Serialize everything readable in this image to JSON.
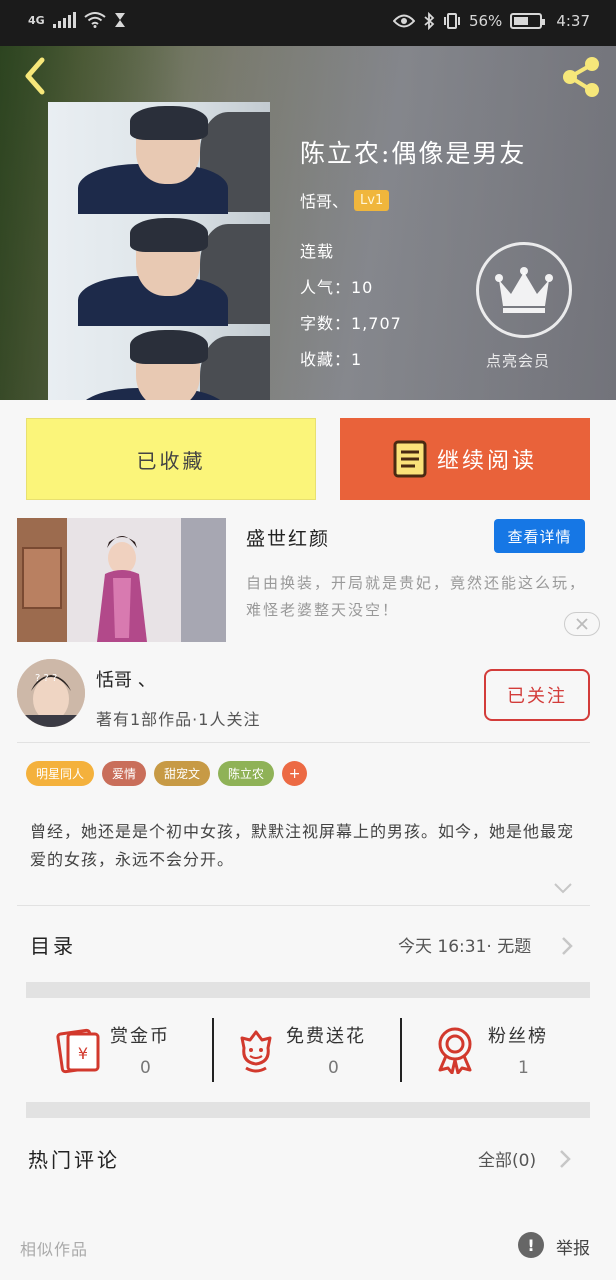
{
  "status_bar": {
    "network": "4G",
    "battery": "56%",
    "time": "4:37"
  },
  "book": {
    "title": "陈立农:偶像是男友",
    "author": "恬哥、",
    "level": "Lv1",
    "status": "连载",
    "popularity": "人气：10",
    "word_count": "字数：1,707",
    "favorites": "收藏：1",
    "vip_label": "点亮会员"
  },
  "actions": {
    "favorited_label": "已收藏",
    "continue_label": "继续阅读"
  },
  "ad": {
    "title": "盛世红颜",
    "detail_button": "查看详情",
    "description": "自由换装，开局就是贵妃，竟然还能这么玩，难怪老婆整天没空！"
  },
  "author_card": {
    "name": "恬哥 、",
    "stats": "著有1部作品·1人关注",
    "follow_label": "已关注",
    "avatar_text": "? ? ?"
  },
  "tags": [
    {
      "label": "明星同人",
      "color": "#f4b13c"
    },
    {
      "label": "爱情",
      "color": "#c96e5a"
    },
    {
      "label": "甜宠文",
      "color": "#c79a45"
    },
    {
      "label": "陈立农",
      "color": "#8fb257"
    },
    {
      "label": "+",
      "color": "#ec6a44"
    }
  ],
  "synopsis": "曾经，她还是是个初中女孩，默默注视屏幕上的男孩。如今，她是他最宠爱的女孩，永远不会分开。",
  "catalog": {
    "label": "目录",
    "latest": "今天 16:31· 无题"
  },
  "stats": [
    {
      "label": "赏金币",
      "value": "0",
      "icon": "red-envelope-icon"
    },
    {
      "label": "免费送花",
      "value": "0",
      "icon": "flower-icon"
    },
    {
      "label": "粉丝榜",
      "value": "1",
      "icon": "medal-icon"
    }
  ],
  "comments": {
    "label": "热门评论",
    "all": "全部(0)"
  },
  "footer": {
    "similar": "相似作品",
    "report": "举报",
    "report_icon": "!"
  },
  "colors": {
    "primary_orange": "#e9623a",
    "fav_yellow": "#fbf57a",
    "follow_red": "#d33c3a",
    "ad_blue": "#1677e5"
  }
}
